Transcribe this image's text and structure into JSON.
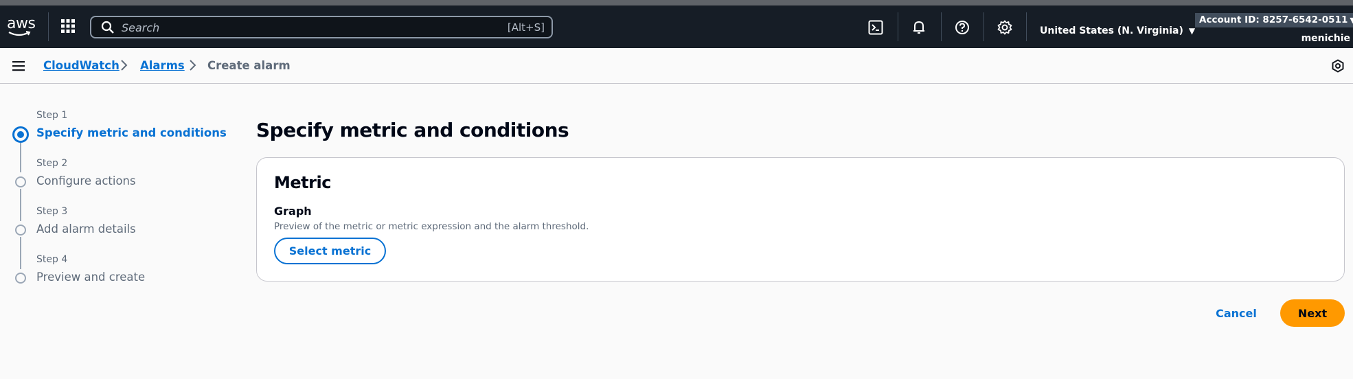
{
  "nav": {
    "logo_text": "aws",
    "search_placeholder": "Search",
    "search_shortcut": "[Alt+S]",
    "region_label": "United States (N. Virginia)",
    "region_caret": "▼",
    "account_label": "Account ID: 8257-6542-0511",
    "account_caret": "▼",
    "username": "menichie",
    "icons": [
      "cloudshell-icon",
      "bell-icon",
      "help-icon",
      "settings-icon"
    ]
  },
  "breadcrumbs": {
    "items": [
      {
        "label": "CloudWatch",
        "link": true
      },
      {
        "label": "Alarms",
        "link": true
      },
      {
        "label": "Create alarm",
        "link": false
      }
    ]
  },
  "wizard": {
    "steps": [
      {
        "label": "Step 1",
        "title": "Specify metric and conditions",
        "active": true
      },
      {
        "label": "Step 2",
        "title": "Configure actions",
        "active": false
      },
      {
        "label": "Step 3",
        "title": "Add alarm details",
        "active": false
      },
      {
        "label": "Step 4",
        "title": "Preview and create",
        "active": false
      }
    ]
  },
  "main": {
    "title": "Specify metric and conditions",
    "panel": {
      "title": "Metric",
      "graph_label": "Graph",
      "graph_desc": "Preview of the metric or metric expression and the alarm threshold.",
      "select_button": "Select metric"
    },
    "cancel_label": "Cancel",
    "next_label": "Next"
  },
  "colors": {
    "nav_bg": "#161d26",
    "link_blue": "#0972d3",
    "primary_orange": "#ff9900",
    "page_bg": "#fafafa"
  }
}
